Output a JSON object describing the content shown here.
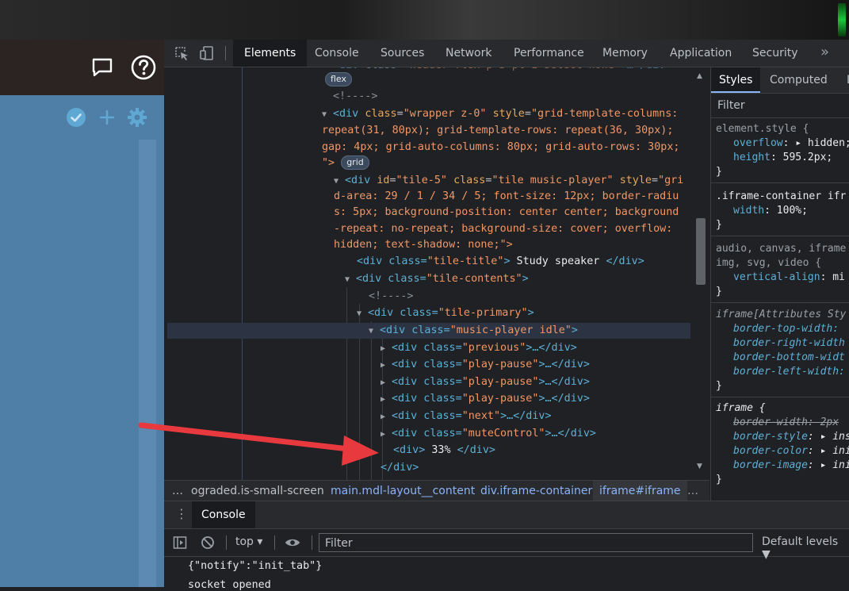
{
  "devtools": {
    "tabs": [
      "Elements",
      "Console",
      "Sources",
      "Network",
      "Performance",
      "Memory",
      "Application",
      "Security"
    ],
    "more_tabs": "»"
  },
  "elements": {
    "top_badge": "flex",
    "comment": "<!---->",
    "wrapper_open": "<div",
    "wrapper_attr_class": "class",
    "wrapper_class_val": "\"wrapper z-0\"",
    "wrapper_attr_style": "style",
    "wrapper_style_1": "\"grid-template-columns:",
    "wrapper_style_2": "repeat(31, 80px); grid-template-rows: repeat(36, 30px);",
    "wrapper_style_3": "gap: 4px; grid-auto-columns: 80px; grid-auto-rows: 30px;",
    "wrapper_style_4": "\">",
    "grid_badge": "grid",
    "tile_line_1a": "<div",
    "tile_id_attr": "id",
    "tile_id_val": "\"tile-5\"",
    "tile_class_attr": "class",
    "tile_class_val": "\"tile music-player\"",
    "tile_style_attr": "style",
    "tile_style_1": "\"gri",
    "tile_style_2": "d-area: 29 / 1 / 34 / 5; font-size: 12px; border-radiu",
    "tile_style_3": "s: 5px; background-position: center center; background",
    "tile_style_4": "-repeat: no-repeat; background-size: cover; overflow:",
    "tile_style_5": "hidden; text-shadow: none;\">",
    "tile_title_open": "<div class=",
    "tile_title_class": "\"tile-title\"",
    "tile_title_text": " Study speaker ",
    "tile_title_close": "</div>",
    "tile_contents_open": "<div class=",
    "tile_contents_class": "\"tile-contents\"",
    "tile_primary_class": "\"tile-primary\"",
    "music_player_class": "\"music-player idle\"",
    "children": [
      {
        "class": "\"previous\"",
        "rest": ">…</div>"
      },
      {
        "class": "\"play-pause\"",
        "rest": ">…</div>"
      },
      {
        "class": "\"play-pause\"",
        "rest": ">…</div>"
      },
      {
        "class": "\"play-pause\"",
        "rest": ">…</div>"
      },
      {
        "class": "\"next\"",
        "rest": ">…</div>"
      },
      {
        "class": "\"muteControl\"",
        "rest": ">…</div>"
      }
    ],
    "percent_open": "<div>",
    "percent_text": " 33% ",
    "percent_close": "</div>",
    "closing_div": "</div>"
  },
  "breadcrumbs": {
    "ellipsis": "…",
    "items": [
      "ograded.is-small-screen",
      "main.mdl-layout__content",
      "div.iframe-container",
      "iframe#iframe"
    ],
    "trailing": "…"
  },
  "styles": {
    "tabs": [
      "Styles",
      "Computed",
      "L"
    ],
    "filter_placeholder": "Filter",
    "rules": {
      "element_style": {
        "selector": "element.style {",
        "p1_name": "overflow",
        "p1_val": "▸ hidden;",
        "p2_name": "height",
        "p2_val": "595.2px;"
      },
      "iframe_container": {
        "selector": ".iframe-container ifr",
        "p1_name": "width",
        "p1_val": "100%;"
      },
      "ua": {
        "selector_1": "audio, canvas, iframe",
        "selector_2": "img, svg, video {",
        "p1_name": "vertical-align",
        "p1_val": "mi"
      },
      "attrs": {
        "selector": "iframe[Attributes Sty",
        "p1": "border-top-width:",
        "p2": "border-right-width",
        "p3": "border-bottom-widt",
        "p4": "border-left-width:"
      },
      "iframe": {
        "selector": "iframe {",
        "p1_name": "border-width",
        "p1_val": "2px",
        "p2_name": "border-style",
        "p2_val": "▸ ins",
        "p3_name": "border-color",
        "p3_val": "▸ ini",
        "p4_name": "border-image",
        "p4_val": "▸ ini"
      },
      "close": "}"
    }
  },
  "console": {
    "tab_label": "Console",
    "context": "top",
    "filter_placeholder": "Filter",
    "levels": "Default levels ▼",
    "messages": [
      "{\"notify\":\"init_tab\"}",
      "socket opened"
    ]
  },
  "colors": {
    "arrow": "#e8393f",
    "app_blue": "#4f7ea6",
    "check": "#5fa8d3"
  }
}
